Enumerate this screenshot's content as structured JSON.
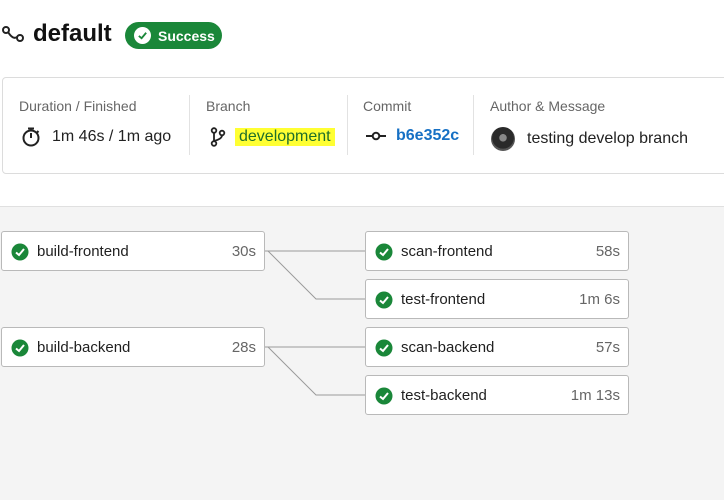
{
  "header": {
    "title": "default",
    "status": "Success",
    "colors": {
      "success": "#1a8739",
      "link": "#1670c4",
      "highlight": "#ffff33"
    }
  },
  "info": {
    "duration": {
      "label": "Duration / Finished",
      "value": "1m 46s / 1m ago",
      "icon": "stopwatch-icon"
    },
    "branch": {
      "label": "Branch",
      "value": "development",
      "icon": "git-branch-icon"
    },
    "commit": {
      "label": "Commit",
      "value": "b6e352c",
      "icon": "git-commit-icon"
    },
    "author": {
      "label": "Author & Message",
      "message": "testing develop branch",
      "icon": "avatar"
    }
  },
  "jobs": [
    {
      "name": "build-frontend",
      "duration": "30s",
      "status": "success"
    },
    {
      "name": "scan-frontend",
      "duration": "58s",
      "status": "success"
    },
    {
      "name": "test-frontend",
      "duration": "1m 6s",
      "status": "success"
    },
    {
      "name": "build-backend",
      "duration": "28s",
      "status": "success"
    },
    {
      "name": "scan-backend",
      "duration": "57s",
      "status": "success"
    },
    {
      "name": "test-backend",
      "duration": "1m 13s",
      "status": "success"
    }
  ]
}
